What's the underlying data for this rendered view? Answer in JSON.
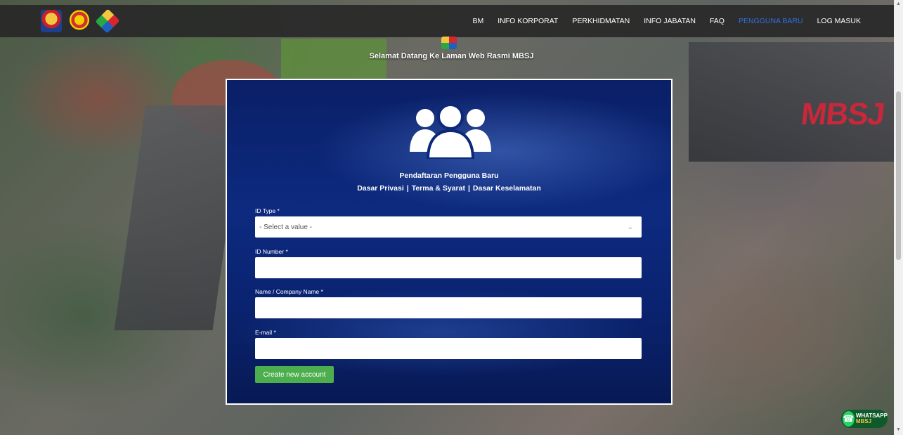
{
  "nav": {
    "items": [
      {
        "label": "BM"
      },
      {
        "label": "INFO KORPORAT"
      },
      {
        "label": "PERKHIDMATAN"
      },
      {
        "label": "INFO JABATAN"
      },
      {
        "label": "FAQ"
      },
      {
        "label": "PENGGUNA BARU",
        "active": true
      },
      {
        "label": "LOG MASUK"
      }
    ],
    "active_color": "#2f6fe0"
  },
  "welcome": {
    "text": "Selamat Datang Ke Laman Web Rasmi MBSJ"
  },
  "background": {
    "sign_text": "MBSJ"
  },
  "panel": {
    "title": "Pendaftaran Pengguna Baru",
    "links": [
      "Dasar Privasi",
      "Terma & Syarat",
      "Dasar Keselamatan"
    ],
    "separator": "|",
    "icon": "users-group-icon"
  },
  "form": {
    "id_type": {
      "label": "ID Type *",
      "value": "- Select a value -"
    },
    "id_number": {
      "label": "ID Number *",
      "value": ""
    },
    "name": {
      "label": "Name / Company Name *",
      "value": ""
    },
    "email": {
      "label": "E-mail *",
      "value": ""
    },
    "submit_label": "Create new account",
    "submit_color": "#4cae4c"
  },
  "whatsapp": {
    "line1": "WHATSAPP",
    "line2": "MBSJ",
    "icon": "phone-icon"
  }
}
